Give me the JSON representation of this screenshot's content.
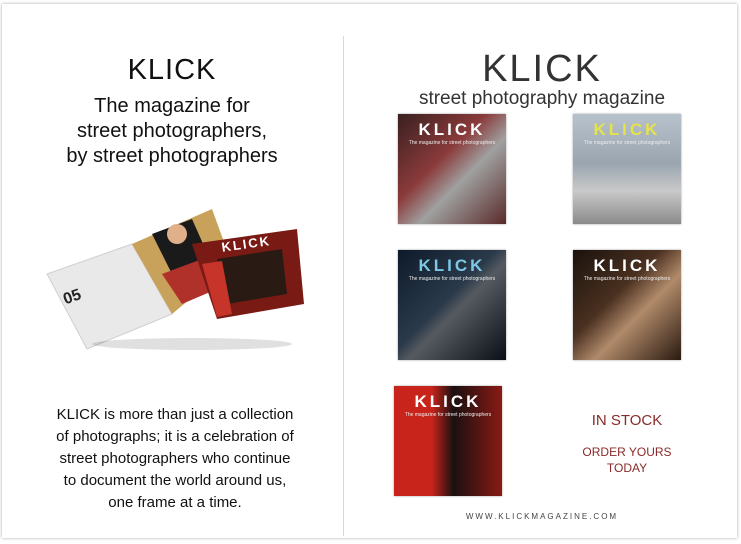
{
  "left": {
    "title": "KLICK",
    "subtitle_lines": [
      "The magazine for",
      "street photographers,",
      "by street photographers"
    ],
    "body_lines": [
      "KLICK is more than just a collection",
      "of photographs; it is a celebration of",
      "street photographers who continue",
      "to document the world around us,",
      "one frame at a time."
    ],
    "mockup": {
      "issue_number": "05",
      "cover_logo": "KLICK"
    }
  },
  "right": {
    "title": "KLICK",
    "subtitle": "street photography magazine",
    "covers": [
      {
        "logo": "KLICK",
        "tag": "The magazine for street photographers"
      },
      {
        "logo": "KLICK",
        "tag": "The magazine for street photographers"
      },
      {
        "logo": "KLICK",
        "tag": "The magazine for street photographers"
      },
      {
        "logo": "KLICK",
        "tag": "The magazine for street photographers"
      },
      {
        "logo": "KLICK",
        "tag": "The magazine for street photographers"
      }
    ],
    "stock_label": "IN STOCK",
    "order_lines": [
      "ORDER YOURS",
      "TODAY"
    ],
    "website": "WWW.KLICKMAGAZINE.COM"
  },
  "colors": {
    "accent": "#8a2a2a"
  }
}
